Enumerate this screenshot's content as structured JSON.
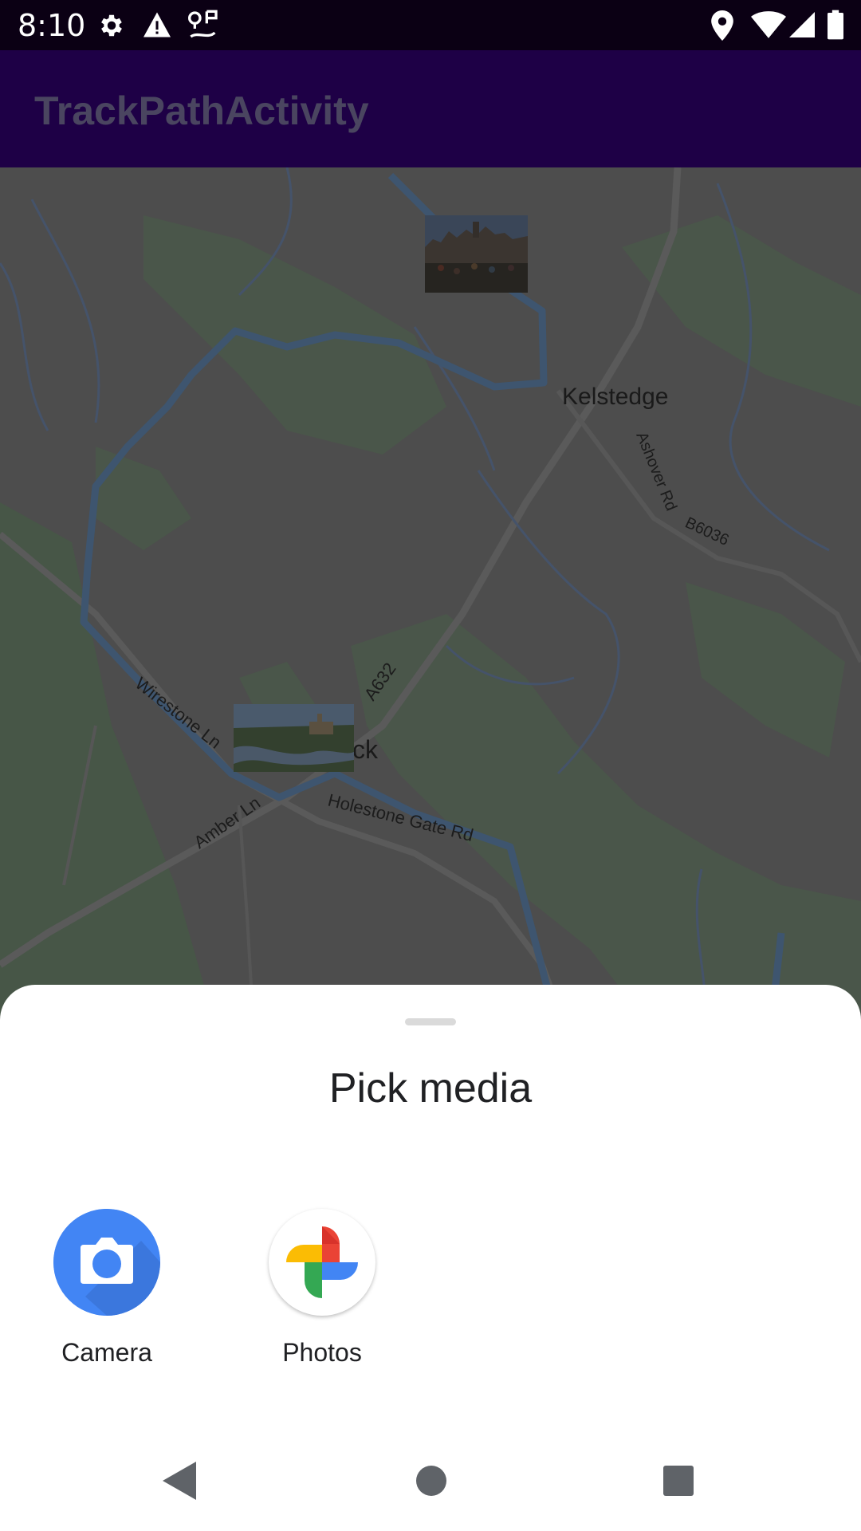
{
  "status_bar": {
    "time": "8:10",
    "left_icons": [
      "gear-icon",
      "warning-icon",
      "route-icon"
    ],
    "right_icons": [
      "location-icon",
      "wifi-icon",
      "signal-icon",
      "battery-icon"
    ]
  },
  "app_bar": {
    "title": "TrackPathActivity",
    "color": "#1e0046"
  },
  "map": {
    "labels": {
      "town_top": "Kelstedge",
      "road_ashover": "Ashover Rd",
      "road_b6036": "B6036",
      "road_a632": "A632",
      "road_wirestone": "Wirestone Ln",
      "road_amber": "Amber Ln",
      "road_holestone": "Holestone Gate Rd",
      "town_partial": "ck"
    },
    "thumbnails": [
      "market-square-photo",
      "river-town-photo"
    ]
  },
  "sheet": {
    "title": "Pick media",
    "apps": [
      {
        "label": "Camera",
        "icon": "camera-icon",
        "color": "#4285f4"
      },
      {
        "label": "Photos",
        "icon": "pinwheel-icon"
      }
    ]
  },
  "nav_bar": {
    "buttons": [
      "back-icon",
      "home-icon",
      "recents-icon"
    ]
  }
}
